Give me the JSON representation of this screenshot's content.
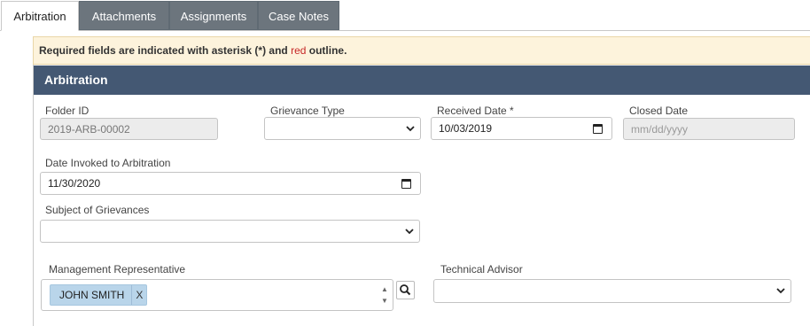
{
  "tabs": [
    {
      "label": "Arbitration"
    },
    {
      "label": "Attachments"
    },
    {
      "label": "Assignments"
    },
    {
      "label": "Case Notes"
    }
  ],
  "alert": {
    "text_before": "Required fields are indicated with asterisk (*) and ",
    "text_red": "red",
    "text_after": " outline."
  },
  "section": {
    "title": "Arbitration"
  },
  "form": {
    "folder_id": {
      "label": "Folder ID",
      "value": "2019-ARB-00002"
    },
    "grievance_type": {
      "label": "Grievance Type",
      "value": ""
    },
    "received_date": {
      "label": "Received Date *",
      "value": "10/03/2019"
    },
    "closed_date": {
      "label": "Closed Date",
      "placeholder": "mm/dd/yyyy"
    },
    "date_invoked": {
      "label": "Date Invoked to Arbitration",
      "value": "11/30/2020"
    },
    "subject": {
      "label": "Subject of Grievances",
      "value": ""
    },
    "management_rep": {
      "label": "Management Representative",
      "token": "JOHN SMITH",
      "remove": "X"
    },
    "technical_advisor": {
      "label": "Technical Advisor",
      "value": ""
    }
  },
  "icons": {
    "calendar": "calendar-icon",
    "dropdown": "chevron-down-icon",
    "search": "search-icon"
  }
}
